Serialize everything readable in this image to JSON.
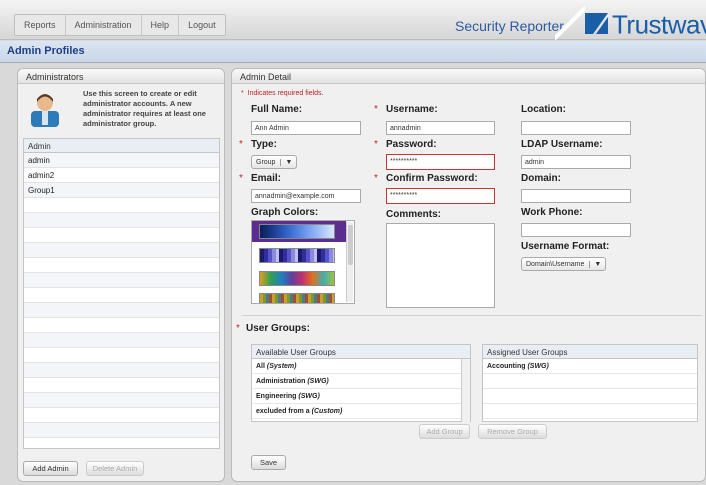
{
  "nav": {
    "items": [
      "Reports",
      "Administration",
      "Help",
      "Logout"
    ]
  },
  "brand": {
    "app_name": "Security Reporter",
    "logo": "Trustwave",
    "trademark": "®"
  },
  "page": {
    "title": "Admin Profiles"
  },
  "administrators": {
    "title": "Administrators",
    "intro": "Use this screen to create or edit administrator accounts. A new administrator requires at least one administrator group.",
    "column": "Admin",
    "rows": [
      "admin",
      "admin2",
      "Group1"
    ],
    "add_button": "Add Admin",
    "delete_button": "Delete Admin"
  },
  "detail": {
    "title": "Admin Detail",
    "required_note": "Indicates required fields.",
    "full_name": {
      "label": "Full Name:",
      "value": "Ann Admin"
    },
    "username": {
      "label": "Username:",
      "value": "annadmin"
    },
    "location": {
      "label": "Location:",
      "value": ""
    },
    "type": {
      "label": "Type:",
      "value": "Group"
    },
    "password": {
      "label": "Password:",
      "value": "**********"
    },
    "ldap_username": {
      "label": "LDAP Username:",
      "value": "admin"
    },
    "email": {
      "label": "Email:",
      "value": "annadmin@example.com"
    },
    "confirm_password": {
      "label": "Confirm Password:",
      "value": "**********"
    },
    "domain": {
      "label": "Domain:",
      "value": ""
    },
    "graph_colors": {
      "label": "Graph Colors:"
    },
    "comments": {
      "label": "Comments:"
    },
    "work_phone": {
      "label": "Work Phone:",
      "value": ""
    },
    "username_format": {
      "label": "Username Format:",
      "value": "Domain\\Username"
    },
    "user_groups": {
      "label": "User Groups:",
      "available_header": "Available User Groups",
      "assigned_header": "Assigned User Groups",
      "available": [
        {
          "name": "All",
          "kind": "(System)"
        },
        {
          "name": "Administration",
          "kind": "(SWG)"
        },
        {
          "name": "Engineering",
          "kind": "(SWG)"
        },
        {
          "name": "excluded from a",
          "kind": "(Custom)"
        }
      ],
      "assigned": [
        {
          "name": "Accounting",
          "kind": "(SWG)"
        }
      ],
      "add_button": "Add Group",
      "remove_button": "Remove Group"
    },
    "save_button": "Save"
  },
  "colors": {
    "accent": "#1d3f8a",
    "error": "#cc3333",
    "selected_swatch": "#5b2d8e"
  }
}
